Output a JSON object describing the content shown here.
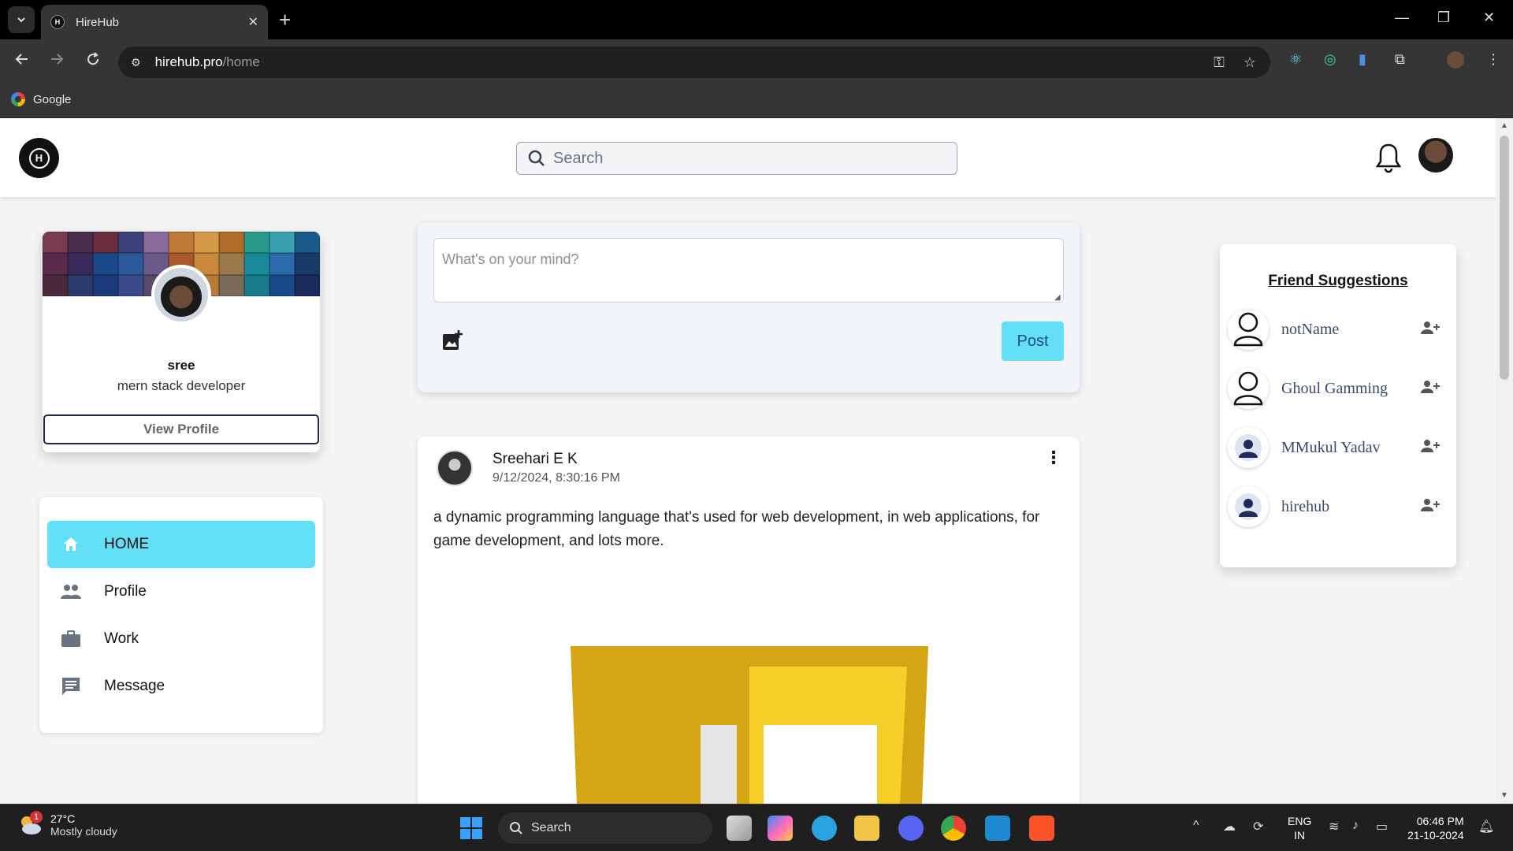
{
  "browser": {
    "tab_title": "HireHub",
    "url_host": "hirehub.pro",
    "url_path": "/home",
    "bookmark_label": "Google"
  },
  "header": {
    "logo_letter": "H",
    "search_placeholder": "Search"
  },
  "profile": {
    "name": "sree",
    "role": "mern stack developer",
    "view_profile_label": "View Profile"
  },
  "nav": {
    "items": [
      {
        "label": "HOME",
        "icon": "home-icon",
        "active": true
      },
      {
        "label": "Profile",
        "icon": "people-icon",
        "active": false
      },
      {
        "label": "Work",
        "icon": "briefcase-icon",
        "active": false
      },
      {
        "label": "Message",
        "icon": "message-icon",
        "active": false
      }
    ]
  },
  "composer": {
    "placeholder": "What's on your mind?",
    "post_label": "Post"
  },
  "post": {
    "author": "Sreehari E K",
    "timestamp": "9/12/2024, 8:30:16 PM",
    "text": "a dynamic programming language that's used for web development, in web applications, for game development, and lots more."
  },
  "suggestions": {
    "title": "Friend Suggestions",
    "items": [
      {
        "name": "notName",
        "avatar": "default-user-icon"
      },
      {
        "name": "Ghoul Gamming",
        "avatar": "default-user-icon"
      },
      {
        "name": "MMukul Yadav",
        "avatar": "user-avatar"
      },
      {
        "name": "hirehub",
        "avatar": "user-avatar"
      }
    ]
  },
  "taskbar": {
    "weather_badge": "1",
    "temperature": "27°C",
    "weather_desc": "Mostly cloudy",
    "search_label": "Search",
    "lang_top": "ENG",
    "lang_bottom": "IN",
    "time": "06:46 PM",
    "date": "21-10-2024"
  },
  "colors": {
    "accent": "#63e0f5",
    "post_button_text": "#1b4a8a",
    "suggestion_name": "#3b4a6b"
  }
}
